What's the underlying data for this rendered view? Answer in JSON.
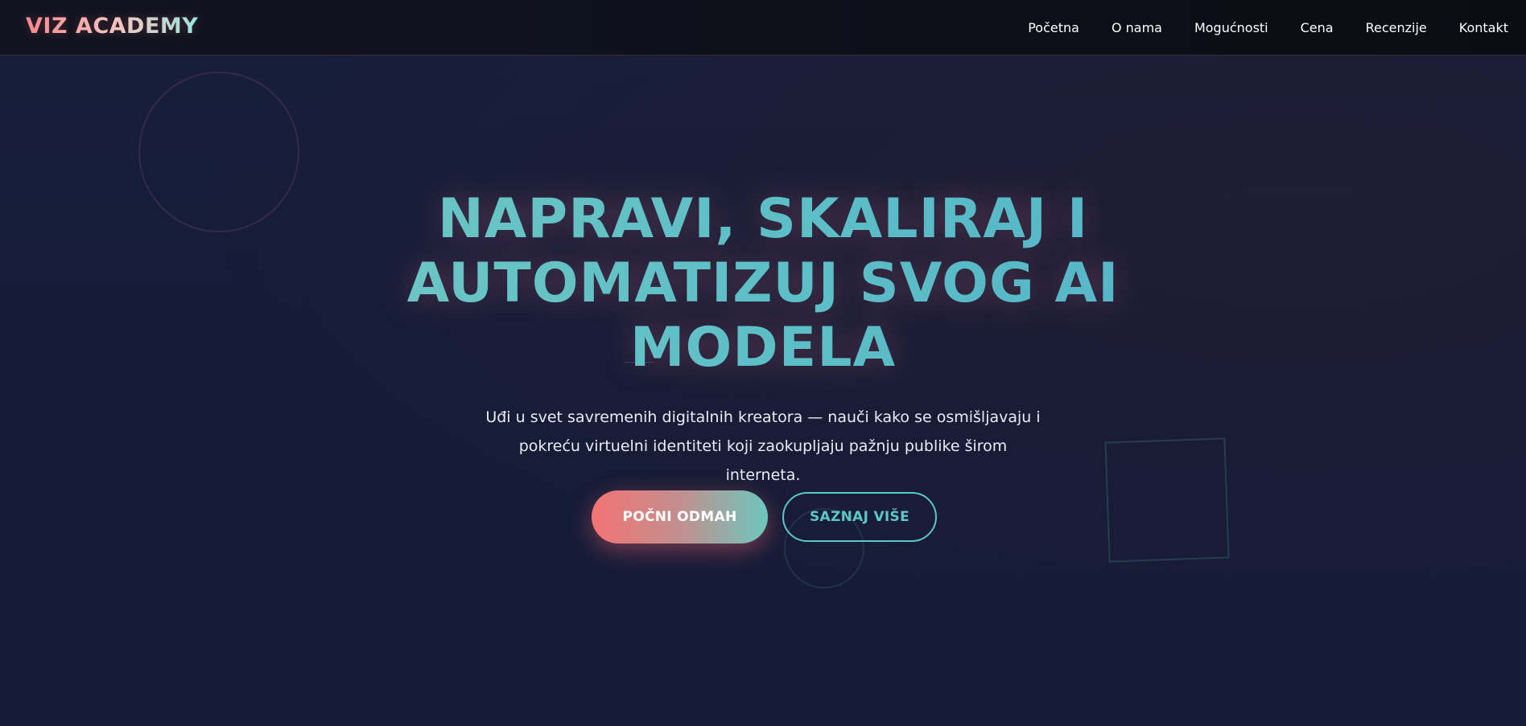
{
  "brand": {
    "logo_text": "VIZ ACADEMY"
  },
  "nav": {
    "items": [
      {
        "label": "Početna"
      },
      {
        "label": "O nama"
      },
      {
        "label": "Mogućnosti"
      },
      {
        "label": "Cena"
      },
      {
        "label": "Recenzije"
      },
      {
        "label": "Kontakt"
      }
    ]
  },
  "hero": {
    "title_lines": [
      "NAPRAVI, SKALIRAJ I",
      "AUTOMATIZUJ SVOG AI",
      "MODELA"
    ],
    "subtitle_lines": [
      "Uđi u svet savremenih digitalnih kreatora — nauči kako se osmišljavaju i",
      "pokreću virtuelni identiteti koji zaokupljaju pažnju publike širom interneta."
    ],
    "primary_button": "POČNI ODMAH",
    "secondary_button": "SAZNAJ VIŠE"
  },
  "colors": {
    "background": "#161d38",
    "navbar": "#0d1019",
    "accent_teal": "#5cc8c6",
    "accent_coral": "#f47373",
    "text": "#ffffff"
  }
}
